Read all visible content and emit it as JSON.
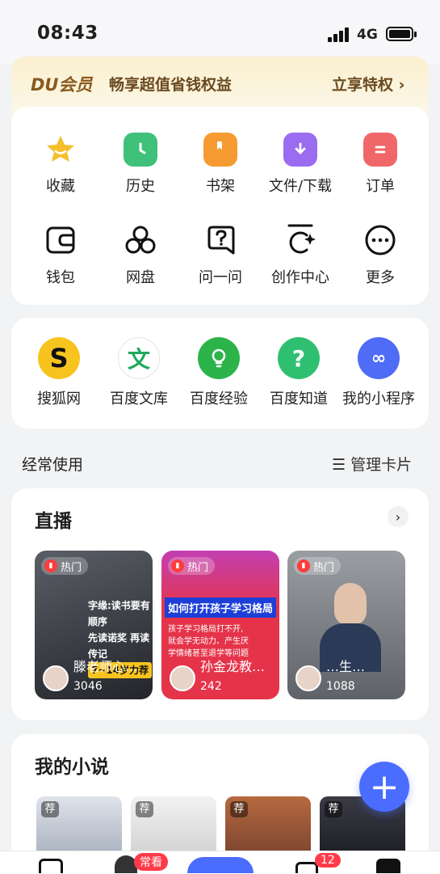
{
  "status_bar": {
    "time": "08:43",
    "network": "4G"
  },
  "vip": {
    "logo": "DU会员",
    "text": "畅享超值省钱权益",
    "cta": "立享特权"
  },
  "shortcuts": [
    {
      "label": "收藏",
      "icon": "star-icon",
      "color": "#f5c02d"
    },
    {
      "label": "历史",
      "icon": "clock-icon",
      "color": "#3fc17a"
    },
    {
      "label": "书架",
      "icon": "bookmark-icon",
      "color": "#f59b32"
    },
    {
      "label": "文件/下载",
      "icon": "folder-download-icon",
      "color": "#9a6cf0"
    },
    {
      "label": "订单",
      "icon": "clipboard-icon",
      "color": "#f0676a"
    },
    {
      "label": "钱包",
      "icon": "wallet-icon"
    },
    {
      "label": "网盘",
      "icon": "cloud-drive-icon"
    },
    {
      "label": "问一问",
      "icon": "question-icon"
    },
    {
      "label": "创作中心",
      "icon": "creation-icon"
    },
    {
      "label": "更多",
      "icon": "more-icon"
    }
  ],
  "apps": [
    {
      "label": "搜狐网",
      "icon": "sohu-icon"
    },
    {
      "label": "百度文库",
      "icon": "wenku-icon"
    },
    {
      "label": "百度经验",
      "icon": "jingyan-icon"
    },
    {
      "label": "百度知道",
      "icon": "zhidao-icon"
    },
    {
      "label": "我的小程序",
      "icon": "mini-program-icon"
    }
  ],
  "frequent": {
    "label": "经常使用",
    "manage": "管理卡片"
  },
  "live": {
    "title": "直播",
    "items": [
      {
        "tag": "热门",
        "name": "滕老师心…",
        "count": "3046",
        "overlay_lines": [
          "字缘:读书要有顺序",
          "先读诺奖 再读传记",
          "7~14岁力荐"
        ]
      },
      {
        "tag": "热门",
        "name": "孙金龙教…",
        "count": "242",
        "overlay_lines": [
          "如何打开孩子学习格局",
          "孩子学习格局打不开,",
          "就会学无动力、产生厌",
          "学情绪甚至退学等问题"
        ]
      },
      {
        "tag": "热门",
        "name": "…生…",
        "count": "1088",
        "overlay_lines": []
      }
    ]
  },
  "novels": {
    "title": "我的小说",
    "items": [
      {
        "tag": "荐"
      },
      {
        "tag": "荐"
      },
      {
        "tag": "荐"
      },
      {
        "tag": "荐"
      }
    ]
  },
  "tabbar": {
    "badge_label": "常看",
    "message_count": "12"
  },
  "fab": {
    "label": "+"
  }
}
